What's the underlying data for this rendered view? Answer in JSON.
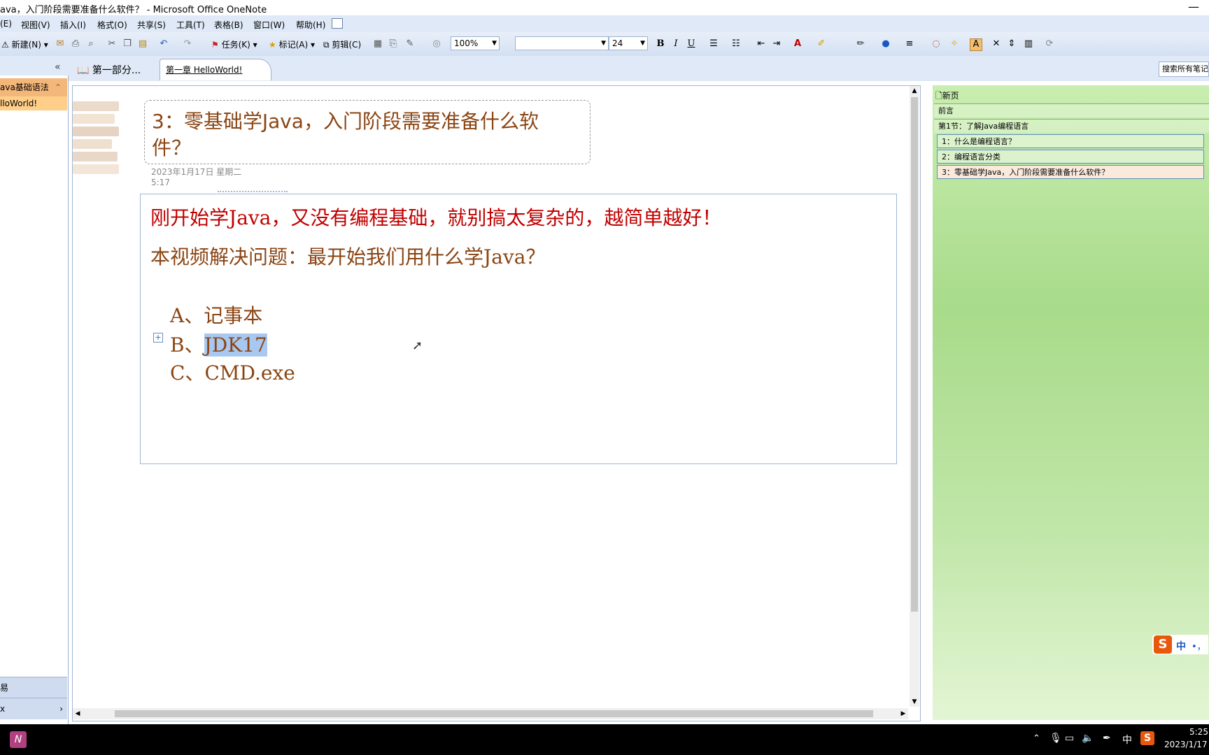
{
  "window": {
    "title": "ava，入门阶段需要准备什么软件？ - Microsoft Office OneNote",
    "minimize": "—"
  },
  "menu": [
    "(E)",
    "视图(V)",
    "插入(I)",
    "格式(O)",
    "共享(S)",
    "工具(T)",
    "表格(B)",
    "窗口(W)",
    "帮助(H)"
  ],
  "toolbar": {
    "new_label": "新建(N)",
    "task_label": "任务(K)",
    "mark_label": "标记(A)",
    "clip_label": "剪辑(C)",
    "zoom": "100%",
    "font_name": "",
    "font_size": "24",
    "bold": "B",
    "italic": "I",
    "underline": "U"
  },
  "tabs": {
    "section_group": "第一部分...",
    "active_section": "第一章  HelloWorld!"
  },
  "search": {
    "placeholder": "搜索所有笔记"
  },
  "leftnav": {
    "collapse": "«",
    "items": [
      "ava基础语法",
      "lloWorld!"
    ],
    "bottom1": "易",
    "bottom2": "x"
  },
  "page": {
    "title_line1": "3：零基础学Java，入门阶段需要准备什么软",
    "title_line2": "件？",
    "date": "2023年1月17日 星期二",
    "time": "5:17",
    "line1": "刚开始学Java，又没有编程基础，就别搞太复杂的，越简单越好！",
    "line2": "本视频解决问题：最开始我们用什么学Java？",
    "options": [
      {
        "prefix": "A、",
        "text": "记事本"
      },
      {
        "prefix": "B、",
        "text": "JDK17"
      },
      {
        "prefix": "C、",
        "text": "CMD.exe"
      }
    ],
    "expand": "+"
  },
  "rightpane": {
    "new_page": "新页",
    "pages": [
      "前言",
      "第1节：了解Java编程语言",
      "1：什么是编程语言？",
      "2：编程语言分类",
      "3：零基础学Java，入门阶段需要准备什么软件？"
    ]
  },
  "ime": {
    "logo": "S",
    "lang": "中",
    "punct": "•，"
  },
  "taskbar": {
    "time": "5:25",
    "date": "2023/1/17",
    "ime_lang": "中",
    "sogou": "S"
  },
  "colors": {
    "title_brown": "#8b4513",
    "red_text": "#c00000",
    "selection": "#a8c8f0",
    "right_pane_green": "#b4e29a"
  }
}
